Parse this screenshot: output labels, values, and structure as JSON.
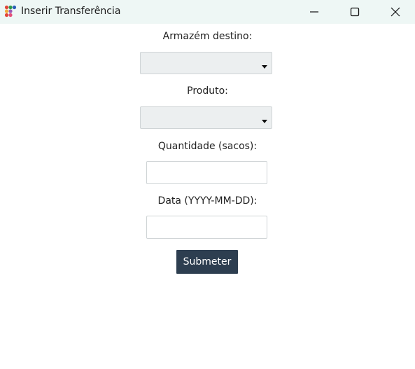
{
  "window": {
    "title": "Inserir Transferência",
    "icon": "app-dots-icon",
    "controls": [
      "minimize-icon",
      "maximize-icon",
      "close-icon"
    ]
  },
  "form": {
    "warehouse_label": "Armazém destino:",
    "warehouse_value": "",
    "product_label": "Produto:",
    "product_value": "",
    "quantity_label": "Quantidade (sacos):",
    "quantity_value": "",
    "date_label": "Data (YYYY-MM-DD):",
    "date_value": "",
    "submit_label": "Submeter"
  },
  "colors": {
    "titlebar": "#eef7f5",
    "select_bg": "#eceff0",
    "button_bg": "#2d3e50",
    "button_text": "#ffffff"
  }
}
